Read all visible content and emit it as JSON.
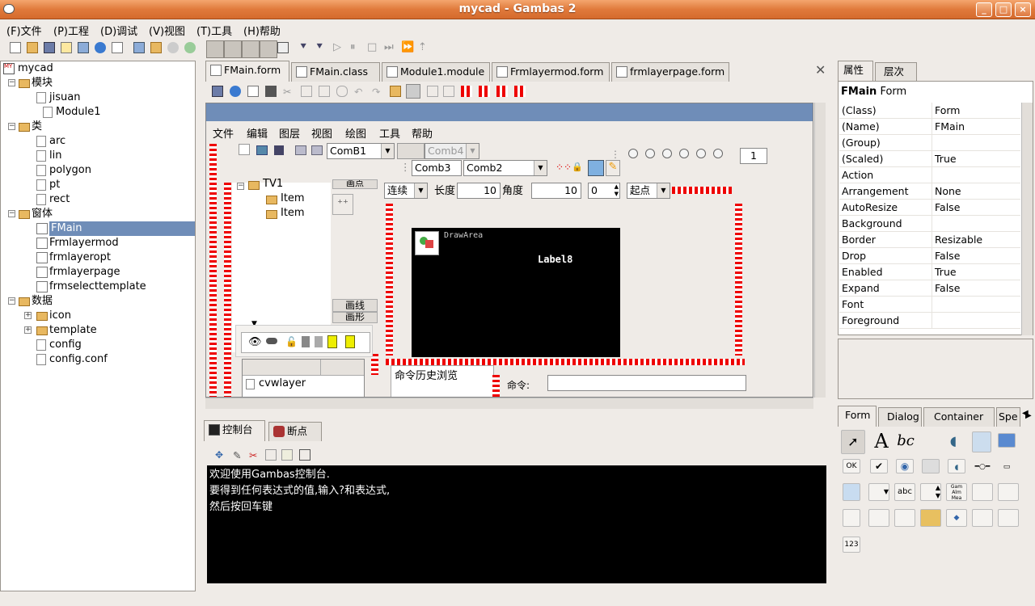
{
  "window": {
    "title": "mycad - Gambas 2"
  },
  "menu": [
    "(F)文件",
    "(P)工程",
    "(D)调试",
    "(V)视图",
    "(T)工具",
    "(H)帮助"
  ],
  "tree": {
    "root": "mycad",
    "items": [
      {
        "label": "模块",
        "kind": "folder",
        "indent": 1,
        "expand": "−"
      },
      {
        "label": "jisuan",
        "kind": "doc",
        "indent": 2
      },
      {
        "label": "Module1",
        "kind": "doc",
        "indent": 3
      },
      {
        "label": "类",
        "kind": "folder",
        "indent": 1,
        "expand": "−"
      },
      {
        "label": "arc",
        "kind": "doc",
        "indent": 2
      },
      {
        "label": "lin",
        "kind": "doc",
        "indent": 2
      },
      {
        "label": "polygon",
        "kind": "doc",
        "indent": 2
      },
      {
        "label": "pt",
        "kind": "doc",
        "indent": 2
      },
      {
        "label": "rect",
        "kind": "doc",
        "indent": 2
      },
      {
        "label": "窗体",
        "kind": "folder",
        "indent": 1,
        "expand": "−"
      },
      {
        "label": "FMain",
        "kind": "form",
        "indent": 2,
        "selected": true
      },
      {
        "label": "Frmlayermod",
        "kind": "form",
        "indent": 2
      },
      {
        "label": "frmlayeropt",
        "kind": "form",
        "indent": 2
      },
      {
        "label": "frmlayerpage",
        "kind": "form",
        "indent": 2
      },
      {
        "label": "frmselecttemplate",
        "kind": "form",
        "indent": 2
      },
      {
        "label": "数据",
        "kind": "folder",
        "indent": 1,
        "expand": "−"
      },
      {
        "label": "icon",
        "kind": "folder",
        "indent": 2,
        "expand": "+"
      },
      {
        "label": "template",
        "kind": "folder",
        "indent": 2,
        "expand": "+"
      },
      {
        "label": "config",
        "kind": "doc",
        "indent": 2
      },
      {
        "label": "config.conf",
        "kind": "doc",
        "indent": 2
      }
    ]
  },
  "editor_tabs": [
    "FMain.form",
    "FMain.class",
    "Module1.module",
    "Frmlayermod.form",
    "frmlayerpage.form"
  ],
  "form": {
    "menu": [
      "文件",
      "编辑",
      "图层",
      "视图",
      "绘图",
      "工具",
      "帮助"
    ],
    "comb1": "ComB1",
    "comb4": "Comb4",
    "comb3": "Comb3",
    "comb2": "Comb2",
    "page_num": "1",
    "tree_root": "TV1",
    "tree_items": [
      "Item",
      "Item"
    ],
    "btn_top": "画点",
    "btn_line": "画线",
    "btn_rect": "画形",
    "mode": "连续",
    "len_label": "长度",
    "len_val": "10",
    "ang_label": "角度",
    "ang_val": "10",
    "spin_val": "0",
    "start": "起点",
    "drawarea": "DrawArea",
    "label8": "Label8",
    "history": "命令历史浏览",
    "cmd_label": "命令:",
    "layer_item": "cvwlayer"
  },
  "console": {
    "tabs": [
      "控制台",
      "断点"
    ],
    "lines": [
      "欢迎使用Gambas控制台.",
      "要得到任何表达式的值,输入?和表达式,",
      "然后按回车键"
    ]
  },
  "props": {
    "tabs": [
      "属性",
      "层次"
    ],
    "header_name": "FMain",
    "header_type": "Form",
    "rows": [
      [
        "(Class)",
        "Form"
      ],
      [
        "(Name)",
        "FMain"
      ],
      [
        "(Group)",
        ""
      ],
      [
        "(Scaled)",
        "True"
      ],
      [
        "Action",
        ""
      ],
      [
        "Arrangement",
        "None"
      ],
      [
        "AutoResize",
        "False"
      ],
      [
        "Background",
        ""
      ],
      [
        "Border",
        "Resizable"
      ],
      [
        "Drop",
        "False"
      ],
      [
        "Enabled",
        "True"
      ],
      [
        "Expand",
        "False"
      ],
      [
        "Font",
        ""
      ],
      [
        "Foreground",
        ""
      ]
    ]
  },
  "toolbox": {
    "tabs": [
      "Form",
      "Dialog",
      "Container",
      "Spe"
    ],
    "ok": "OK",
    "abc": "abc",
    "num": "123"
  },
  "colors": {
    "title": "#e07a3c",
    "selection": "#6f8db8",
    "console_bg": "#000000"
  }
}
